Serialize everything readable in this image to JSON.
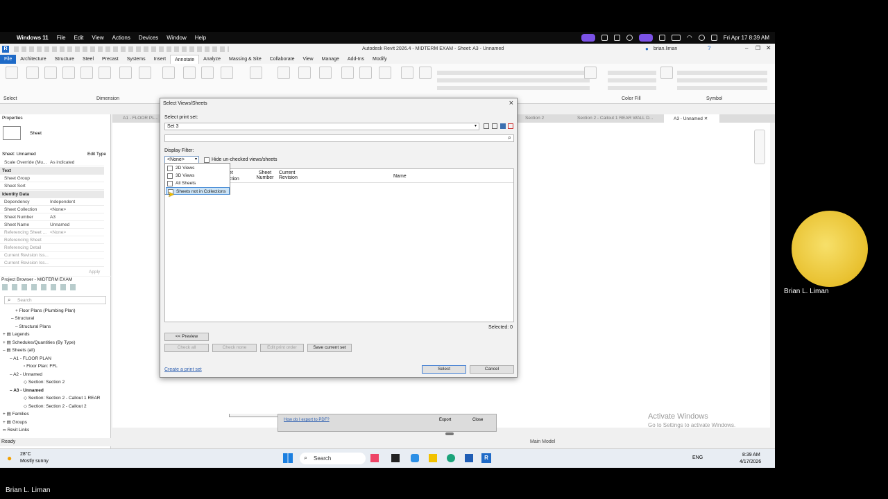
{
  "mac": {
    "menu": [
      "Windows 11",
      "File",
      "Edit",
      "View",
      "Actions",
      "Devices",
      "Window",
      "Help"
    ],
    "datetime": "Fri Apr 17  8:39 AM"
  },
  "revit": {
    "title": "Autodesk Revit 2026.4 - MIDTERM EXAM - Sheet: A3 - Unnamed",
    "user": "brian.liman",
    "tabs": [
      "File",
      "Architecture",
      "Structure",
      "Steel",
      "Precast",
      "Systems",
      "Insert",
      "Annotate",
      "Analyze",
      "Massing & Site",
      "Collaborate",
      "View",
      "Manage",
      "Add-Ins",
      "Modify"
    ],
    "ribbon_groups": [
      "Select",
      "Dimension",
      "Color Fill",
      "Symbol"
    ],
    "view_tabs": [
      "A1 - FLOOR PL...",
      "Section 2",
      "Section 2 - Callout 1 REAR WALL D...",
      "A3 - Unnamed"
    ],
    "status": "Ready",
    "status_model": "Main Model",
    "activate": "Activate Windows",
    "activate_sub": "Go to Settings to activate Windows."
  },
  "properties": {
    "header": "Properties",
    "type": "Sheet",
    "instance": "Sheet: Unnamed",
    "edit_type": "Edit Type",
    "scale_label": "Scale Override (Mu...",
    "scale_value": "As indicated",
    "groups": [
      "Text",
      "Identity Data"
    ],
    "rows": [
      {
        "k": "Sheet Group",
        "v": ""
      },
      {
        "k": "Sheet Sort",
        "v": ""
      },
      {
        "k": "Dependency",
        "v": "Independent"
      },
      {
        "k": "Sheet Collection",
        "v": "<None>"
      },
      {
        "k": "Sheet Number",
        "v": "A3"
      },
      {
        "k": "Sheet Name",
        "v": "Unnamed"
      },
      {
        "k": "Referencing Sheet ...",
        "v": "<None>"
      },
      {
        "k": "Referencing Sheet",
        "v": ""
      },
      {
        "k": "Referencing Detail",
        "v": ""
      },
      {
        "k": "Current Revision Iss...",
        "v": ""
      },
      {
        "k": "Current Revision Iss...",
        "v": ""
      }
    ],
    "apply": "Apply"
  },
  "browser": {
    "title": "Project Browser - MIDTERM EXAM",
    "search": "Search",
    "items": [
      "Floor Plans (Plumbing Plan)",
      "Structural",
      "Structural Plans",
      "Legends",
      "Schedules/Quantities (By Type)",
      "Sheets (all)",
      "A1 - FLOOR PLAN",
      "Floor Plan: FFL",
      "A2 - Unnamed",
      "Section: Section 2",
      "A3 - Unnamed",
      "Section: Section 2 - Callout 1 REAR",
      "Section: Section 2 - Callout 2",
      "Families",
      "Groups",
      "Revit Links"
    ]
  },
  "dialog": {
    "title": "Select Views/Sheets",
    "print_set_label": "Select print set:",
    "print_set": "Set 3",
    "display_filter_label": "Display Filter:",
    "filter_value": "<None>",
    "hide_unchecked": "Hide un-checked views/sheets",
    "filter_options": [
      "2D Views",
      "3D Views",
      "All Sheets",
      "Sheets not in Collections"
    ],
    "columns": [
      "Sheet Collection",
      "Sheet Number",
      "Current Revision",
      "Name"
    ],
    "col_partial": [
      "et",
      "ction"
    ],
    "selected": "Selected: 0",
    "preview": "<< Preview",
    "check_all": "Check all",
    "check_none": "Check none",
    "edit_print_order": "Edit print order",
    "save_current_set": "Save current set",
    "create_print_set": "Create a print set",
    "select": "Select",
    "cancel": "Cancel"
  },
  "behind": {
    "help_link": "How do I export to PDF?",
    "export": "Export",
    "close": "Close"
  },
  "taskbar": {
    "temp": "28°C",
    "weather": "Mostly sunny",
    "search": "Search",
    "lang": "ENG",
    "time": "8:39 AM",
    "date": "4/17/2026"
  },
  "presenter": "Brian L. Liman",
  "footer_name": "Brian L. Liman"
}
